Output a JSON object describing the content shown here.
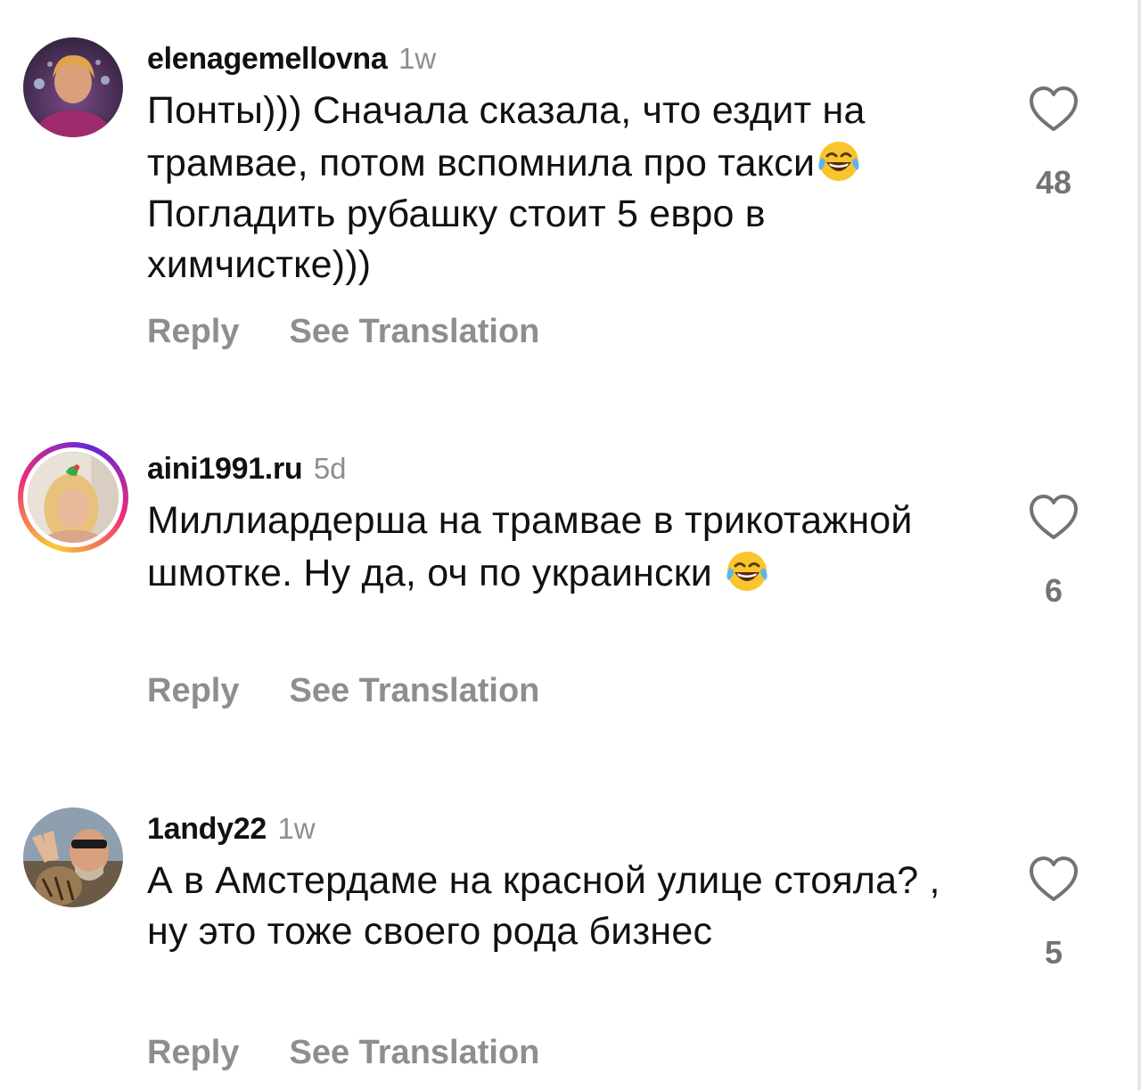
{
  "colors": {
    "text": "#111111",
    "muted": "#8e8e8e",
    "heart_outline": "#737373",
    "story_ring": [
      "#f9ce34",
      "#ee2a7b",
      "#6228d7"
    ]
  },
  "comments": [
    {
      "username": "elenagemellovna",
      "time": "1w",
      "text_part1": "Понты))) Сначала сказала, что ездит на трамвае, потом вспомнила про такси",
      "emoji": "face-with-tears-of-joy",
      "text_part2": " Погладить рубашку стоит 5 евро в химчистке)))",
      "reply_label": "Reply",
      "translate_label": "See Translation",
      "likes": "48",
      "has_story_ring": false
    },
    {
      "username": "aini1991.ru",
      "time": "5d",
      "text_part1": "Миллиардерша на трамвае в трикотажной шмотке. Ну да, оч по украински ",
      "emoji": "face-with-tears-of-joy",
      "text_part2": "",
      "reply_label": "Reply",
      "translate_label": "See Translation",
      "likes": "6",
      "has_story_ring": true
    },
    {
      "username": "1andy22",
      "time": "1w",
      "text_part1": "А в Амстердаме на красной улице стояла? , ну это тоже своего рода бизнес",
      "reply_label": "Reply",
      "translate_label": "See Translation",
      "likes": "5",
      "has_story_ring": false
    }
  ]
}
